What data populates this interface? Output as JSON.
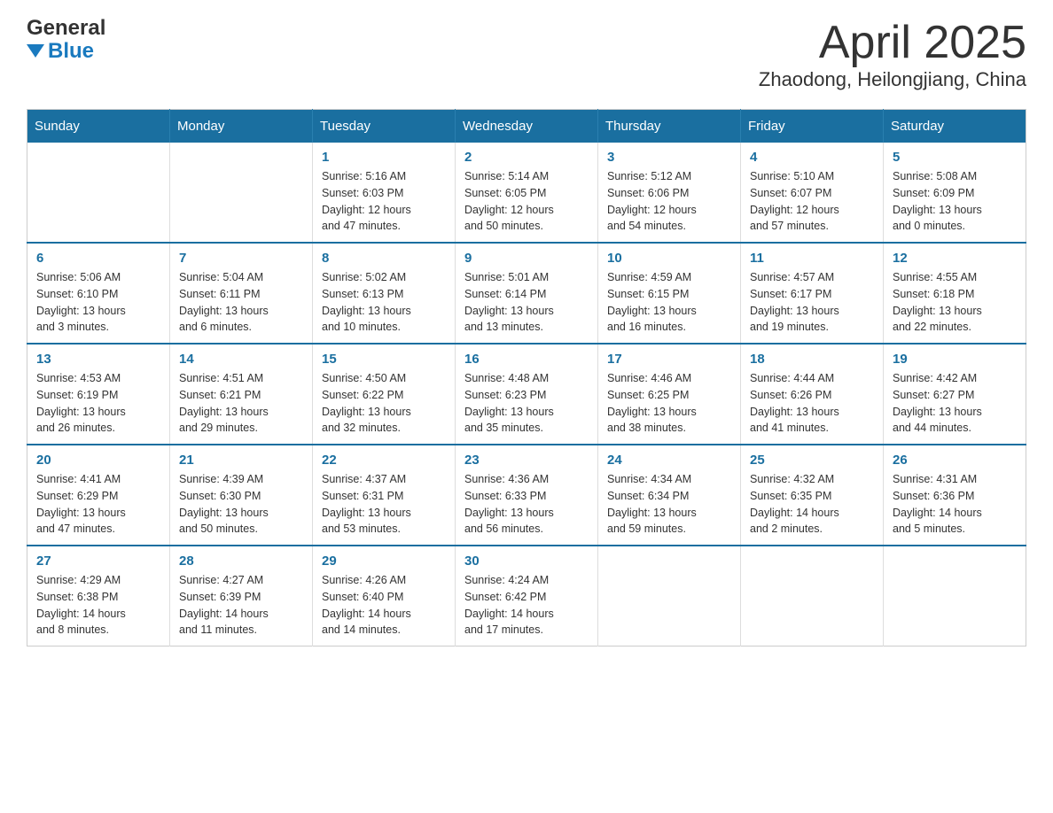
{
  "header": {
    "logo_line1": "General",
    "logo_line2": "Blue",
    "month_title": "April 2025",
    "location": "Zhaodong, Heilongjiang, China"
  },
  "calendar": {
    "days_of_week": [
      "Sunday",
      "Monday",
      "Tuesday",
      "Wednesday",
      "Thursday",
      "Friday",
      "Saturday"
    ],
    "weeks": [
      [
        {
          "day": "",
          "info": ""
        },
        {
          "day": "",
          "info": ""
        },
        {
          "day": "1",
          "info": "Sunrise: 5:16 AM\nSunset: 6:03 PM\nDaylight: 12 hours\nand 47 minutes."
        },
        {
          "day": "2",
          "info": "Sunrise: 5:14 AM\nSunset: 6:05 PM\nDaylight: 12 hours\nand 50 minutes."
        },
        {
          "day": "3",
          "info": "Sunrise: 5:12 AM\nSunset: 6:06 PM\nDaylight: 12 hours\nand 54 minutes."
        },
        {
          "day": "4",
          "info": "Sunrise: 5:10 AM\nSunset: 6:07 PM\nDaylight: 12 hours\nand 57 minutes."
        },
        {
          "day": "5",
          "info": "Sunrise: 5:08 AM\nSunset: 6:09 PM\nDaylight: 13 hours\nand 0 minutes."
        }
      ],
      [
        {
          "day": "6",
          "info": "Sunrise: 5:06 AM\nSunset: 6:10 PM\nDaylight: 13 hours\nand 3 minutes."
        },
        {
          "day": "7",
          "info": "Sunrise: 5:04 AM\nSunset: 6:11 PM\nDaylight: 13 hours\nand 6 minutes."
        },
        {
          "day": "8",
          "info": "Sunrise: 5:02 AM\nSunset: 6:13 PM\nDaylight: 13 hours\nand 10 minutes."
        },
        {
          "day": "9",
          "info": "Sunrise: 5:01 AM\nSunset: 6:14 PM\nDaylight: 13 hours\nand 13 minutes."
        },
        {
          "day": "10",
          "info": "Sunrise: 4:59 AM\nSunset: 6:15 PM\nDaylight: 13 hours\nand 16 minutes."
        },
        {
          "day": "11",
          "info": "Sunrise: 4:57 AM\nSunset: 6:17 PM\nDaylight: 13 hours\nand 19 minutes."
        },
        {
          "day": "12",
          "info": "Sunrise: 4:55 AM\nSunset: 6:18 PM\nDaylight: 13 hours\nand 22 minutes."
        }
      ],
      [
        {
          "day": "13",
          "info": "Sunrise: 4:53 AM\nSunset: 6:19 PM\nDaylight: 13 hours\nand 26 minutes."
        },
        {
          "day": "14",
          "info": "Sunrise: 4:51 AM\nSunset: 6:21 PM\nDaylight: 13 hours\nand 29 minutes."
        },
        {
          "day": "15",
          "info": "Sunrise: 4:50 AM\nSunset: 6:22 PM\nDaylight: 13 hours\nand 32 minutes."
        },
        {
          "day": "16",
          "info": "Sunrise: 4:48 AM\nSunset: 6:23 PM\nDaylight: 13 hours\nand 35 minutes."
        },
        {
          "day": "17",
          "info": "Sunrise: 4:46 AM\nSunset: 6:25 PM\nDaylight: 13 hours\nand 38 minutes."
        },
        {
          "day": "18",
          "info": "Sunrise: 4:44 AM\nSunset: 6:26 PM\nDaylight: 13 hours\nand 41 minutes."
        },
        {
          "day": "19",
          "info": "Sunrise: 4:42 AM\nSunset: 6:27 PM\nDaylight: 13 hours\nand 44 minutes."
        }
      ],
      [
        {
          "day": "20",
          "info": "Sunrise: 4:41 AM\nSunset: 6:29 PM\nDaylight: 13 hours\nand 47 minutes."
        },
        {
          "day": "21",
          "info": "Sunrise: 4:39 AM\nSunset: 6:30 PM\nDaylight: 13 hours\nand 50 minutes."
        },
        {
          "day": "22",
          "info": "Sunrise: 4:37 AM\nSunset: 6:31 PM\nDaylight: 13 hours\nand 53 minutes."
        },
        {
          "day": "23",
          "info": "Sunrise: 4:36 AM\nSunset: 6:33 PM\nDaylight: 13 hours\nand 56 minutes."
        },
        {
          "day": "24",
          "info": "Sunrise: 4:34 AM\nSunset: 6:34 PM\nDaylight: 13 hours\nand 59 minutes."
        },
        {
          "day": "25",
          "info": "Sunrise: 4:32 AM\nSunset: 6:35 PM\nDaylight: 14 hours\nand 2 minutes."
        },
        {
          "day": "26",
          "info": "Sunrise: 4:31 AM\nSunset: 6:36 PM\nDaylight: 14 hours\nand 5 minutes."
        }
      ],
      [
        {
          "day": "27",
          "info": "Sunrise: 4:29 AM\nSunset: 6:38 PM\nDaylight: 14 hours\nand 8 minutes."
        },
        {
          "day": "28",
          "info": "Sunrise: 4:27 AM\nSunset: 6:39 PM\nDaylight: 14 hours\nand 11 minutes."
        },
        {
          "day": "29",
          "info": "Sunrise: 4:26 AM\nSunset: 6:40 PM\nDaylight: 14 hours\nand 14 minutes."
        },
        {
          "day": "30",
          "info": "Sunrise: 4:24 AM\nSunset: 6:42 PM\nDaylight: 14 hours\nand 17 minutes."
        },
        {
          "day": "",
          "info": ""
        },
        {
          "day": "",
          "info": ""
        },
        {
          "day": "",
          "info": ""
        }
      ]
    ]
  }
}
